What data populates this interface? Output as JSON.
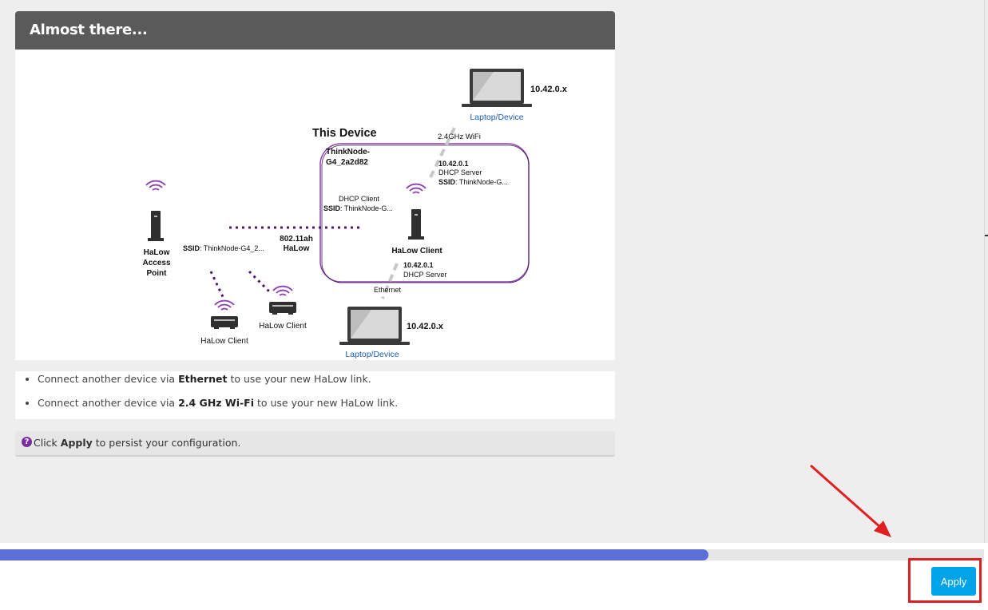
{
  "card": {
    "title": "Almost there..."
  },
  "diagram": {
    "this_device": "This Device",
    "device_name_line1": "ThinkNode-",
    "device_name_line2": "G4_2a2d82",
    "wifi_band": "2.4GHz WiFi",
    "top_laptop_ip": "10.42.0.x",
    "top_laptop_label": "Laptop/Device",
    "dhcp_server_ip_top": "10.42.0.1",
    "dhcp_server_top": "DHCP Server",
    "ssid_key_top": "SSID",
    "ssid_value_top": ": ThinkNode-G...",
    "dhcp_client": "DHCP Client",
    "ssid_key_mid": "SSID",
    "ssid_value_mid": ": ThinkNode-G...",
    "halow_client_center": "HaLow Client",
    "dhcp_server_ip_bottom": "10.42.0.1",
    "dhcp_server_bottom": "DHCP Server",
    "ethernet": "Ethernet",
    "bottom_laptop_ip": "10.42.0.x",
    "bottom_laptop_label": "Laptop/Device",
    "link_standard": "802.11ah",
    "link_name": "HaLow",
    "ap_ssid_key": "SSID",
    "ap_ssid_value": ": ThinkNode-G4_2...",
    "ap_line1": "HaLow",
    "ap_line2": "Access",
    "ap_line3": "Point",
    "client_right": "HaLow Client",
    "client_left": "HaLow Client"
  },
  "steps": [
    {
      "pre": "Connect another device via ",
      "bold": "Ethernet",
      "post": " to use your new HaLow link."
    },
    {
      "pre": "Connect another device via ",
      "bold": "2.4 GHz Wi-Fi",
      "post": " to use your new HaLow link."
    }
  ],
  "hint": {
    "icon": "question-circle-icon",
    "pre": "Click ",
    "bold": "Apply",
    "post": " to persist your configuration."
  },
  "progress": {
    "percent": 72
  },
  "footer": {
    "apply_label": "Apply"
  },
  "colors": {
    "accent": "#00a3e8",
    "progress": "#5b6fd6",
    "halow": "#7b2d9e",
    "highlight": "#e02020"
  }
}
